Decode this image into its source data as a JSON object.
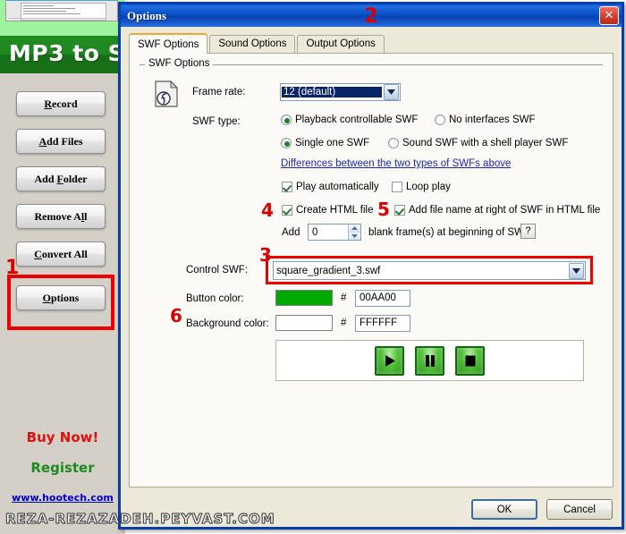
{
  "app": {
    "banner_title": "MP3 to S",
    "buttons": [
      {
        "label_pre": "",
        "label_key": "R",
        "label_post": "ecord",
        "name": "record-button"
      },
      {
        "label_pre": "",
        "label_key": "A",
        "label_post": "dd Files",
        "name": "add-files-button"
      },
      {
        "label_pre": "Add ",
        "label_key": "F",
        "label_post": "older",
        "name": "add-folder-button"
      },
      {
        "label_pre": "Remove A",
        "label_key": "l",
        "label_post": "l",
        "name": "remove-all-button"
      },
      {
        "label_pre": "",
        "label_key": "C",
        "label_post": "onvert All",
        "name": "convert-all-button"
      },
      {
        "label_pre": "",
        "label_key": "O",
        "label_post": "ptions",
        "name": "options-button"
      }
    ],
    "buy_now": "Buy Now!",
    "register": "Register",
    "website": "www.hootech.com"
  },
  "watermark": "REZA-REZAZADEH.PEYVAST.COM",
  "annotations": {
    "n1": "1",
    "n2": "2",
    "n3": "3",
    "n4": "4",
    "n5": "5",
    "n6": "6"
  },
  "dialog": {
    "title": "Options",
    "close_label": "✕",
    "tabs": [
      {
        "label": "SWF Options",
        "active": true
      },
      {
        "label": "Sound Options",
        "active": false
      },
      {
        "label": "Output Options",
        "active": false
      }
    ],
    "group_title": "SWF Options",
    "frame_rate": {
      "label": "Frame rate:",
      "value": "12 (default)"
    },
    "swf_type": {
      "label": "SWF type:",
      "options": [
        {
          "label": "Playback controllable SWF",
          "checked": true
        },
        {
          "label": "No interfaces SWF",
          "checked": false
        },
        {
          "label": "Single one SWF",
          "checked": true
        },
        {
          "label": "Sound SWF with a shell player SWF",
          "checked": false
        }
      ],
      "link": "Differences between the two types of SWFs above"
    },
    "checkboxes": [
      {
        "label": "Play automatically",
        "checked": true,
        "name": "play-automatically-checkbox"
      },
      {
        "label": "Loop play",
        "checked": false,
        "name": "loop-play-checkbox"
      },
      {
        "label": "Create HTML file",
        "checked": true,
        "name": "create-html-file-checkbox"
      },
      {
        "label": "Add file name at right of SWF in HTML file",
        "checked": true,
        "name": "add-file-name-checkbox"
      }
    ],
    "blank_frames": {
      "prefix": "Add",
      "value": "0",
      "suffix": "blank frame(s) at beginning of SWF",
      "help_label": "?"
    },
    "control_swf": {
      "label": "Control SWF:",
      "value": "square_gradient_3.swf"
    },
    "button_color": {
      "label": "Button color:",
      "hash": "#",
      "hex": "00AA00",
      "swatch": "#00AA00"
    },
    "background_color": {
      "label": "Background color:",
      "hash": "#",
      "hex": "FFFFFF",
      "swatch": "#FFFFFF"
    },
    "preview": {
      "play": "play-icon",
      "pause": "pause-icon",
      "stop": "stop-icon"
    },
    "ok_label": "OK",
    "cancel_label": "Cancel"
  }
}
